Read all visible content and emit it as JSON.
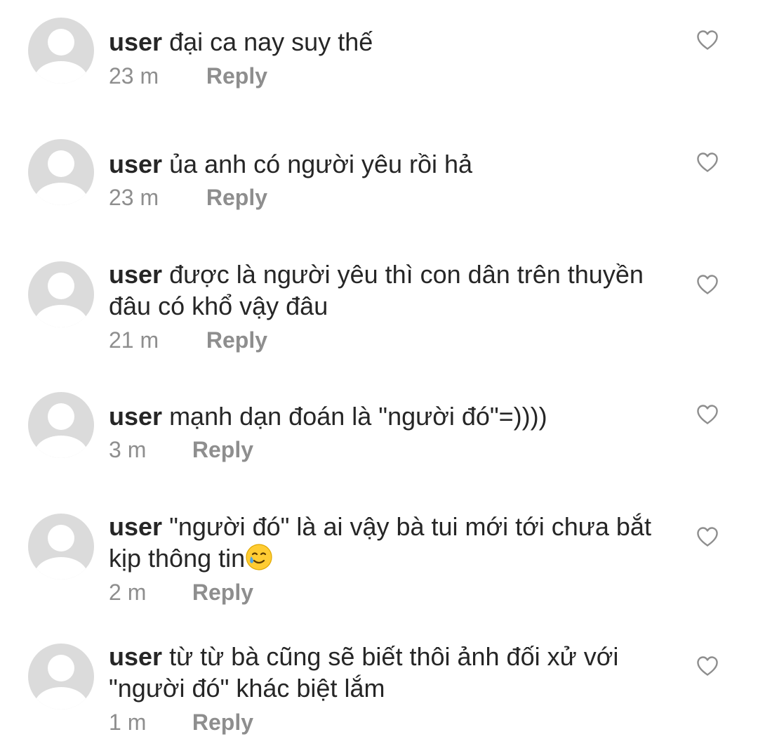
{
  "comments": [
    {
      "username": "user",
      "text": "đại ca nay suy thế",
      "time": "23 m",
      "reply_label": "Reply"
    },
    {
      "username": "user",
      "text": "ủa anh có người yêu rồi hả",
      "time": "23 m",
      "reply_label": "Reply"
    },
    {
      "username": "user",
      "text": "được là người yêu thì con dân trên thuyền đâu có khổ vậy đâu",
      "time": "21 m",
      "reply_label": "Reply"
    },
    {
      "username": "user",
      "text": "mạnh dạn đoán là \"người đó\"=))))",
      "time": "3 m",
      "reply_label": "Reply"
    },
    {
      "username": "user",
      "text": "\"người đó\" là ai vậy bà tui mới tới chưa bắt kịp thông tin",
      "emoji": "smiling-face-with-tear",
      "time": "2 m",
      "reply_label": "Reply"
    },
    {
      "username": "user",
      "text": "từ từ bà cũng sẽ biết thôi ảnh đối xử với \"người đó\" khác biệt lắm",
      "time": "1 m",
      "reply_label": "Reply"
    }
  ],
  "icons": {
    "avatar": "default-profile-avatar",
    "like": "heart-outline-icon"
  },
  "colors": {
    "text": "#262626",
    "secondary": "#8e8e8e",
    "avatar_bg": "#dbdbdb"
  }
}
